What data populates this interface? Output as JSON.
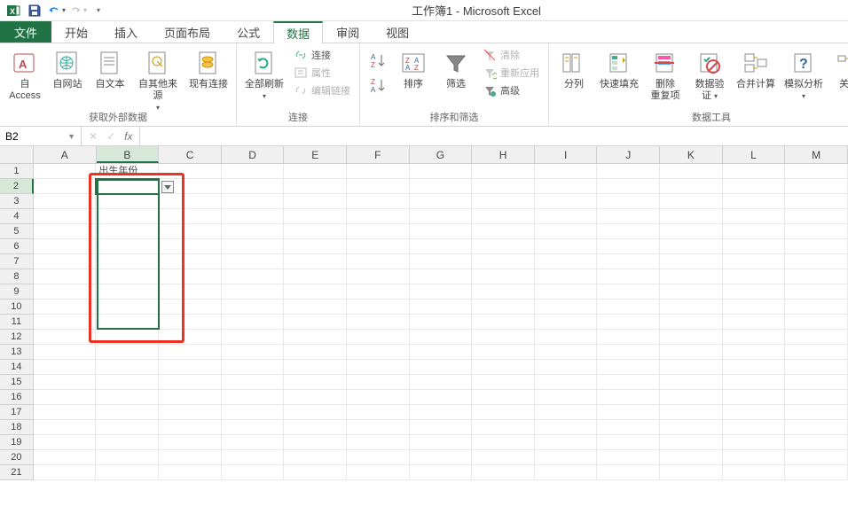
{
  "app": {
    "title": "工作簿1 - Microsoft Excel"
  },
  "tabs": {
    "file": "文件",
    "items": [
      "开始",
      "插入",
      "页面布局",
      "公式",
      "数据",
      "审阅",
      "视图"
    ],
    "active_index": 4
  },
  "ribbon": {
    "groups": [
      {
        "label": "获取外部数据",
        "big_buttons": [
          {
            "label": "自 Access"
          },
          {
            "label": "自网站"
          },
          {
            "label": "自文本"
          },
          {
            "label": "自其他来源",
            "dropdown": true
          },
          {
            "label": "现有连接"
          }
        ]
      },
      {
        "label": "连接",
        "big_buttons": [
          {
            "label": "全部刷新",
            "dropdown": true
          }
        ],
        "small_buttons": [
          {
            "label": "连接",
            "disabled": false
          },
          {
            "label": "属性",
            "disabled": true
          },
          {
            "label": "编辑链接",
            "disabled": true
          }
        ]
      },
      {
        "label": "排序和筛选",
        "sort_small": [
          "A↓Z",
          "Z↓A"
        ],
        "big_buttons": [
          {
            "label": "排序"
          },
          {
            "label": "筛选"
          }
        ],
        "small_buttons": [
          {
            "label": "清除",
            "disabled": true
          },
          {
            "label": "重新应用",
            "disabled": true
          },
          {
            "label": "高级",
            "disabled": false
          }
        ]
      },
      {
        "label": "数据工具",
        "big_buttons": [
          {
            "label": "分列"
          },
          {
            "label": "快速填充"
          },
          {
            "label": "删除\n重复项"
          },
          {
            "label": "数据验\n证",
            "dropdown": true
          },
          {
            "label": "合并计算"
          },
          {
            "label": "模拟分析",
            "dropdown": true
          },
          {
            "label": "关系"
          }
        ]
      }
    ]
  },
  "formula_bar": {
    "name_box": "B2",
    "fx": "fx"
  },
  "grid": {
    "columns": [
      "A",
      "B",
      "C",
      "D",
      "E",
      "F",
      "G",
      "H",
      "I",
      "J",
      "K",
      "L",
      "M"
    ],
    "row_count": 21,
    "b1_text": "出生年份",
    "selected_col": 1,
    "selected_row": 1
  }
}
